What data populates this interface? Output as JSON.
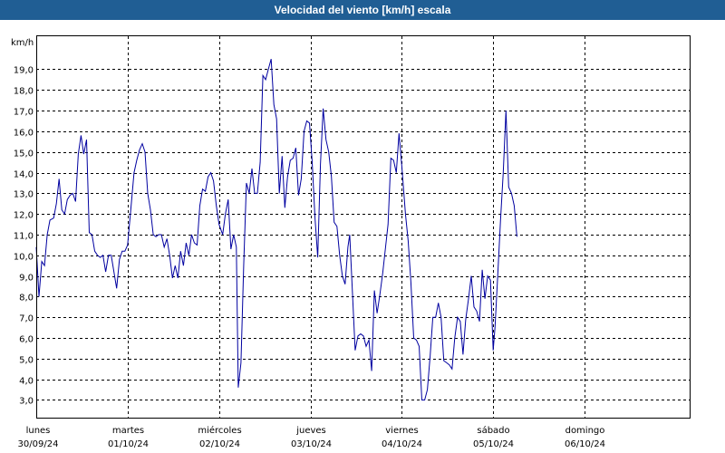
{
  "window": {
    "title": "Velocidad del viento [km/h] escala"
  },
  "chart_data": {
    "type": "line",
    "title": "Velocidad del viento [km/h] escala",
    "ylabel": "km/h",
    "ylim": [
      2.1,
      20.6
    ],
    "yticks": [
      "3,0",
      "4,0",
      "5,0",
      "6,0",
      "7,0",
      "8,0",
      "9,0",
      "10,0",
      "11,0",
      "12,0",
      "13,0",
      "14,0",
      "15,0",
      "16,0",
      "17,0",
      "18,0",
      "19,0"
    ],
    "ytick_values": [
      3,
      4,
      5,
      6,
      7,
      8,
      9,
      10,
      11,
      12,
      13,
      14,
      15,
      16,
      17,
      18,
      19
    ],
    "xlim": [
      0,
      7.15
    ],
    "xticks": [
      {
        "day": "lunes",
        "date": "30/09/24",
        "x": 0
      },
      {
        "day": "martes",
        "date": "01/10/24",
        "x": 1
      },
      {
        "day": "miércoles",
        "date": "02/10/24",
        "x": 2
      },
      {
        "day": "jueves",
        "date": "03/10/24",
        "x": 3
      },
      {
        "day": "viernes",
        "date": "04/10/24",
        "x": 4
      },
      {
        "day": "sábado",
        "date": "05/10/24",
        "x": 5
      },
      {
        "day": "domingo",
        "date": "06/10/24",
        "x": 6
      }
    ],
    "grid": true,
    "series": [
      {
        "color": "#0000a0",
        "points": [
          [
            0.0,
            10.4
          ],
          [
            0.03,
            8.0
          ],
          [
            0.06,
            9.7
          ],
          [
            0.09,
            9.5
          ],
          [
            0.12,
            11.0
          ],
          [
            0.15,
            11.7
          ],
          [
            0.19,
            11.8
          ],
          [
            0.22,
            12.5
          ],
          [
            0.25,
            13.7
          ],
          [
            0.28,
            12.2
          ],
          [
            0.31,
            12.0
          ],
          [
            0.34,
            12.7
          ],
          [
            0.37,
            12.9
          ],
          [
            0.4,
            13.0
          ],
          [
            0.43,
            12.6
          ],
          [
            0.46,
            14.9
          ],
          [
            0.49,
            15.8
          ],
          [
            0.52,
            14.9
          ],
          [
            0.55,
            15.6
          ],
          [
            0.58,
            11.1
          ],
          [
            0.61,
            11.0
          ],
          [
            0.64,
            10.2
          ],
          [
            0.67,
            10.0
          ],
          [
            0.7,
            9.9
          ],
          [
            0.73,
            10.0
          ],
          [
            0.76,
            9.2
          ],
          [
            0.79,
            10.0
          ],
          [
            0.82,
            10.0
          ],
          [
            0.85,
            9.2
          ],
          [
            0.88,
            8.4
          ],
          [
            0.91,
            9.8
          ],
          [
            0.94,
            10.2
          ],
          [
            0.97,
            10.2
          ],
          [
            1.0,
            10.5
          ],
          [
            1.04,
            12.5
          ],
          [
            1.07,
            14.0
          ],
          [
            1.1,
            14.6
          ],
          [
            1.13,
            15.1
          ],
          [
            1.16,
            15.4
          ],
          [
            1.19,
            15.0
          ],
          [
            1.22,
            13.0
          ],
          [
            1.25,
            12.2
          ],
          [
            1.28,
            11.0
          ],
          [
            1.31,
            10.9
          ],
          [
            1.34,
            11.0
          ],
          [
            1.37,
            11.0
          ],
          [
            1.4,
            10.4
          ],
          [
            1.43,
            10.8
          ],
          [
            1.46,
            10.0
          ],
          [
            1.49,
            8.9
          ],
          [
            1.52,
            9.5
          ],
          [
            1.55,
            8.9
          ],
          [
            1.58,
            10.2
          ],
          [
            1.61,
            9.5
          ],
          [
            1.64,
            10.6
          ],
          [
            1.67,
            10.0
          ],
          [
            1.7,
            11.0
          ],
          [
            1.73,
            10.6
          ],
          [
            1.76,
            10.5
          ],
          [
            1.79,
            12.4
          ],
          [
            1.82,
            13.2
          ],
          [
            1.85,
            13.1
          ],
          [
            1.88,
            13.8
          ],
          [
            1.91,
            14.0
          ],
          [
            1.94,
            13.6
          ],
          [
            1.97,
            12.4
          ],
          [
            2.0,
            11.5
          ],
          [
            2.04,
            11.0
          ],
          [
            2.07,
            12.0
          ],
          [
            2.1,
            12.7
          ],
          [
            2.13,
            10.3
          ],
          [
            2.16,
            11.0
          ],
          [
            2.19,
            10.4
          ],
          [
            2.21,
            3.6
          ],
          [
            2.24,
            4.8
          ],
          [
            2.27,
            9.5
          ],
          [
            2.3,
            13.5
          ],
          [
            2.33,
            13.0
          ],
          [
            2.36,
            14.2
          ],
          [
            2.39,
            13.0
          ],
          [
            2.42,
            13.0
          ],
          [
            2.45,
            14.5
          ],
          [
            2.48,
            18.7
          ],
          [
            2.51,
            18.5
          ],
          [
            2.54,
            19.0
          ],
          [
            2.57,
            19.5
          ],
          [
            2.6,
            17.3
          ],
          [
            2.63,
            16.6
          ],
          [
            2.66,
            13.0
          ],
          [
            2.69,
            14.8
          ],
          [
            2.72,
            12.3
          ],
          [
            2.75,
            13.8
          ],
          [
            2.78,
            14.6
          ],
          [
            2.81,
            14.7
          ],
          [
            2.84,
            15.2
          ],
          [
            2.87,
            12.9
          ],
          [
            2.9,
            13.7
          ],
          [
            2.93,
            16.0
          ],
          [
            2.96,
            16.5
          ],
          [
            2.99,
            16.4
          ],
          [
            3.02,
            14.5
          ],
          [
            3.05,
            11.8
          ],
          [
            3.08,
            9.9
          ],
          [
            3.11,
            14.4
          ],
          [
            3.14,
            17.1
          ],
          [
            3.17,
            15.6
          ],
          [
            3.2,
            15.0
          ],
          [
            3.23,
            13.8
          ],
          [
            3.26,
            11.6
          ],
          [
            3.29,
            11.4
          ],
          [
            3.32,
            10.0
          ],
          [
            3.35,
            9.0
          ],
          [
            3.38,
            8.6
          ],
          [
            3.41,
            10.4
          ],
          [
            3.43,
            11.0
          ],
          [
            3.46,
            8.2
          ],
          [
            3.49,
            5.4
          ],
          [
            3.52,
            6.1
          ],
          [
            3.55,
            6.2
          ],
          [
            3.58,
            6.1
          ],
          [
            3.61,
            5.6
          ],
          [
            3.64,
            5.9
          ],
          [
            3.67,
            4.4
          ],
          [
            3.7,
            8.3
          ],
          [
            3.73,
            7.2
          ],
          [
            3.76,
            8.1
          ],
          [
            3.79,
            9.1
          ],
          [
            3.82,
            10.3
          ],
          [
            3.85,
            11.5
          ],
          [
            3.88,
            14.7
          ],
          [
            3.91,
            14.6
          ],
          [
            3.94,
            14.0
          ],
          [
            3.97,
            15.9
          ],
          [
            4.0,
            14.3
          ],
          [
            4.04,
            12.0
          ],
          [
            4.07,
            10.7
          ],
          [
            4.1,
            8.7
          ],
          [
            4.13,
            6.0
          ],
          [
            4.16,
            5.9
          ],
          [
            4.19,
            5.6
          ],
          [
            4.22,
            3.0
          ],
          [
            4.25,
            3.0
          ],
          [
            4.28,
            3.5
          ],
          [
            4.31,
            5.1
          ],
          [
            4.34,
            7.0
          ],
          [
            4.37,
            7.0
          ],
          [
            4.4,
            7.7
          ],
          [
            4.43,
            7.0
          ],
          [
            4.46,
            4.9
          ],
          [
            4.49,
            4.8
          ],
          [
            4.52,
            4.7
          ],
          [
            4.55,
            4.5
          ],
          [
            4.58,
            6.0
          ],
          [
            4.61,
            7.0
          ],
          [
            4.64,
            6.8
          ],
          [
            4.67,
            5.2
          ],
          [
            4.7,
            6.9
          ],
          [
            4.73,
            7.9
          ],
          [
            4.76,
            9.0
          ],
          [
            4.79,
            7.5
          ],
          [
            4.82,
            7.3
          ],
          [
            4.85,
            6.8
          ],
          [
            4.88,
            9.3
          ],
          [
            4.91,
            7.9
          ],
          [
            4.94,
            9.0
          ],
          [
            4.97,
            8.8
          ],
          [
            5.0,
            5.4
          ],
          [
            5.02,
            6.5
          ],
          [
            5.05,
            9.0
          ],
          [
            5.08,
            11.7
          ],
          [
            5.11,
            14.0
          ],
          [
            5.14,
            17.0
          ],
          [
            5.17,
            13.3
          ],
          [
            5.2,
            13.0
          ],
          [
            5.23,
            12.4
          ],
          [
            5.26,
            10.9
          ]
        ]
      }
    ]
  }
}
